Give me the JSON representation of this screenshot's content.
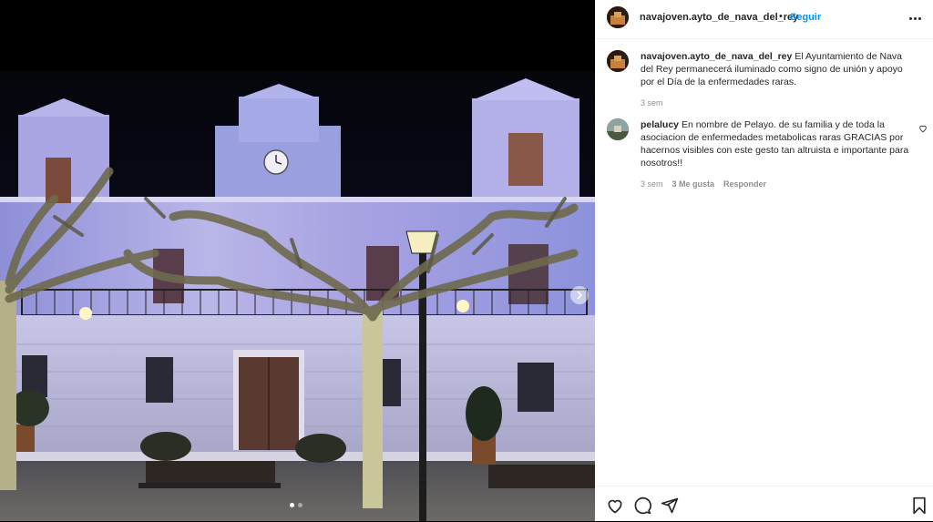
{
  "post": {
    "author": "navajoven.ayto_de_nava_del_rey",
    "separator": "•",
    "follow_label": "Seguir",
    "caption": {
      "author": "navajoven.ayto_de_nava_del_rey",
      "text": "El Ayuntamiento de Nava del Rey permanecerá iluminado como signo de unión y apoyo por el Día de la enfermedades raras.",
      "time": "3 sem"
    },
    "comments": [
      {
        "author": "pelalucy",
        "text": "En nombre de Pelayo. de su familia y de toda la asociacion de enfermedades metabolicas raras GRACIAS por hacernos visibles con este gesto tan altruista e importante para nosotros!!",
        "time": "3 sem",
        "likes": "3 Me gusta",
        "reply_label": "Responder"
      }
    ]
  },
  "media": {
    "slide_count": 2,
    "current_slide": 1,
    "description_icon": "photo-town-hall"
  },
  "icons": {
    "more": "more-options-icon",
    "like": "heart-icon",
    "comment": "comment-icon",
    "share": "share-icon",
    "save": "bookmark-icon",
    "next": "chevron-right-icon"
  },
  "colors": {
    "accent": "#0095f6",
    "text": "#262626",
    "muted": "#8e8e8e"
  }
}
